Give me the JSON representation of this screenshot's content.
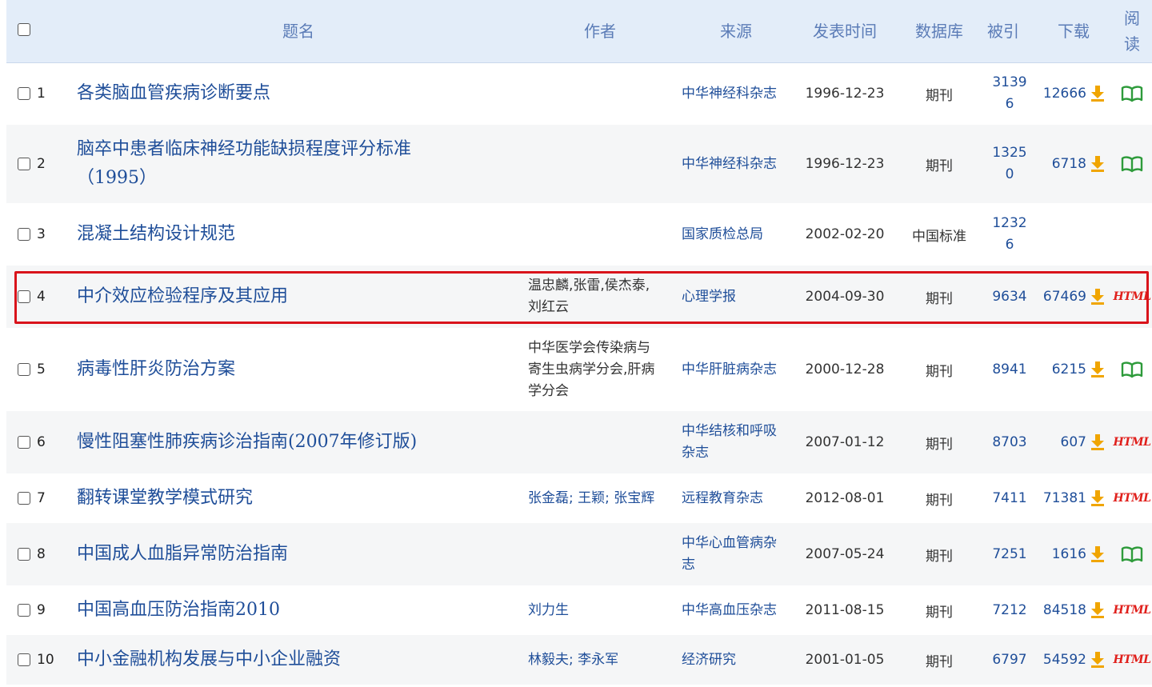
{
  "header": {
    "title": "题名",
    "author": "作者",
    "source": "来源",
    "date": "发表时间",
    "database": "数据库",
    "cited": "被引",
    "download": "下载",
    "read_line1": "阅",
    "read_line2": "读"
  },
  "rows": [
    {
      "num": "1",
      "title1": "各类脑血管疾病诊断要点",
      "title2": "",
      "author1": "",
      "author2": "",
      "author3": "",
      "source1": "中华神经科杂志",
      "source2": "",
      "date": "1996-12-23",
      "db": "期刊",
      "cited1": "3139",
      "cited2": "6",
      "downloads": "12666",
      "read": "book"
    },
    {
      "num": "2",
      "title1": "脑卒中患者临床神经功能缺损程度评分标准",
      "title2": "（1995）",
      "author1": "",
      "author2": "",
      "author3": "",
      "source1": "中华神经科杂志",
      "source2": "",
      "date": "1996-12-23",
      "db": "期刊",
      "cited1": "1325",
      "cited2": "0",
      "downloads": "6718",
      "read": "book"
    },
    {
      "num": "3",
      "title1": "混凝土结构设计规范",
      "title2": "",
      "author1": "",
      "author2": "",
      "author3": "",
      "source1": "国家质检总局",
      "source2": "",
      "date": "2002-02-20",
      "db": "中国标准",
      "cited1": "1232",
      "cited2": "6",
      "downloads": "",
      "read": ""
    },
    {
      "num": "4",
      "title1": "中介效应检验程序及其应用",
      "title2": "",
      "author1": "温忠麟,张雷,侯杰泰,",
      "author2": "刘红云",
      "author3": "",
      "source1": "心理学报",
      "source2": "",
      "date": "2004-09-30",
      "db": "期刊",
      "cited1": "9634",
      "cited2": "",
      "downloads": "67469",
      "read": "HTML"
    },
    {
      "num": "5",
      "title1": "病毒性肝炎防治方案",
      "title2": "",
      "author1": "中华医学会传染病与",
      "author2": "寄生虫病学分会,肝病",
      "author3": "学分会",
      "source1": "中华肝脏病杂志",
      "source2": "",
      "date": "2000-12-28",
      "db": "期刊",
      "cited1": "8941",
      "cited2": "",
      "downloads": "6215",
      "read": "book"
    },
    {
      "num": "6",
      "title1": "慢性阻塞性肺疾病诊治指南(2007年修订版)",
      "title2": "",
      "author1": "",
      "author2": "",
      "author3": "",
      "source1": "中华结核和呼吸",
      "source2": "杂志",
      "date": "2007-01-12",
      "db": "期刊",
      "cited1": "8703",
      "cited2": "",
      "downloads": "607",
      "read": "HTML"
    },
    {
      "num": "7",
      "title1": "翻转课堂教学模式研究",
      "title2": "",
      "author1": "张金磊; 王颖; 张宝辉",
      "author2": "",
      "author3": "",
      "source1": "远程教育杂志",
      "source2": "",
      "date": "2012-08-01",
      "db": "期刊",
      "cited1": "7411",
      "cited2": "",
      "downloads": "71381",
      "read": "HTML"
    },
    {
      "num": "8",
      "title1": "中国成人血脂异常防治指南",
      "title2": "",
      "author1": "",
      "author2": "",
      "author3": "",
      "source1": "中华心血管病杂",
      "source2": "志",
      "date": "2007-05-24",
      "db": "期刊",
      "cited1": "7251",
      "cited2": "",
      "downloads": "1616",
      "read": "book"
    },
    {
      "num": "9",
      "title1": "中国高血压防治指南2010",
      "title2": "",
      "author1": "刘力生",
      "author2": "",
      "author3": "",
      "source1": "中华高血压杂志",
      "source2": "",
      "date": "2011-08-15",
      "db": "期刊",
      "cited1": "7212",
      "cited2": "",
      "downloads": "84518",
      "read": "HTML"
    },
    {
      "num": "10",
      "title1": "中小金融机构发展与中小企业融资",
      "title2": "",
      "author1": "林毅夫; 李永军",
      "author2": "",
      "author3": "",
      "source1": "经济研究",
      "source2": "",
      "date": "2001-01-05",
      "db": "期刊",
      "cited1": "6797",
      "cited2": "",
      "downloads": "54592",
      "read": "HTML"
    }
  ],
  "colors": {
    "link": "#1f4e99",
    "header_text": "#5b7cb7",
    "header_bg": "#e3edf9",
    "highlight": "#d9131b",
    "html_badge": "#e0201c",
    "download_icon": "#f0a500",
    "read_icon": "#2e9b3b"
  }
}
